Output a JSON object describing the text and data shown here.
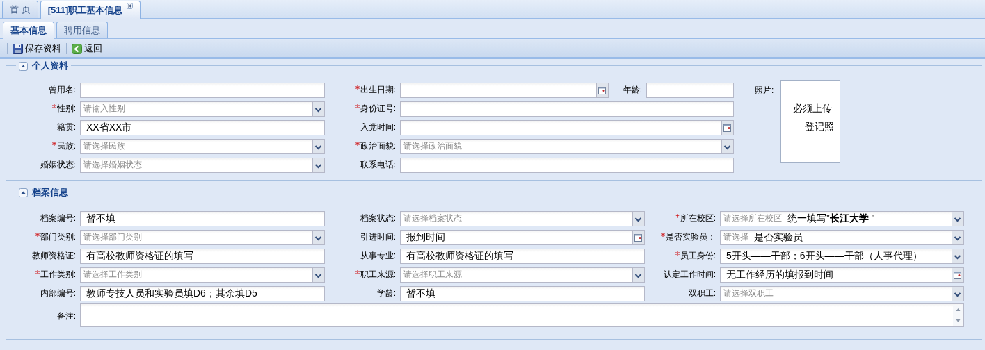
{
  "top_tabs": [
    {
      "label": "首 页",
      "selected": false,
      "closable": false
    },
    {
      "label": "[511]职工基本信息",
      "selected": true,
      "closable": true
    }
  ],
  "sub_tabs": [
    {
      "label": "基本信息",
      "selected": true
    },
    {
      "label": "聘用信息",
      "selected": false
    }
  ],
  "toolbar": [
    {
      "label": "保存资料",
      "kind": "save"
    },
    {
      "label": "返回",
      "kind": "back"
    }
  ],
  "sections": [
    {
      "title": "个人资料",
      "expanded": true,
      "kind": "personal",
      "rows": [
        {
          "fields": [
            {
              "label": "曾用名:",
              "required": false,
              "kind": "text"
            },
            {
              "label": "出生日期:",
              "required": true,
              "kind": "date"
            },
            {
              "label": "年龄:",
              "required": false,
              "kind": "text"
            }
          ]
        },
        {
          "fields": [
            {
              "label": "性别:",
              "required": true,
              "kind": "combo",
              "placeholder": "请输入性别"
            },
            {
              "label": "身份证号:",
              "required": true,
              "kind": "text"
            }
          ]
        },
        {
          "fields": [
            {
              "label": "籍贯:",
              "required": false,
              "kind": "text",
              "value": "XX省XX市"
            },
            {
              "label": "入党时间:",
              "required": false,
              "kind": "date"
            }
          ]
        },
        {
          "fields": [
            {
              "label": "民族:",
              "required": true,
              "kind": "combo",
              "placeholder": "请选择民族"
            },
            {
              "label": "政治面貌:",
              "required": true,
              "kind": "combo",
              "placeholder": "请选择政治面貌"
            }
          ]
        },
        {
          "fields": [
            {
              "label": "婚姻状态:",
              "required": false,
              "kind": "combo",
              "placeholder": "请选择婚姻状态"
            },
            {
              "label": "联系电话:",
              "required": false,
              "kind": "text"
            }
          ]
        }
      ],
      "photo": {
        "label": "照片:",
        "notes": [
          "必须上传",
          "登记照"
        ]
      }
    },
    {
      "title": "档案信息",
      "expanded": true,
      "kind": "archive",
      "rows": [
        {
          "fields": [
            {
              "label": "档案编号:",
              "required": false,
              "kind": "text",
              "value": "暂不填"
            },
            {
              "label": "档案状态:",
              "required": false,
              "kind": "combo",
              "placeholder": "请选择档案状态"
            },
            {
              "label": "所在校区:",
              "required": true,
              "kind": "combo",
              "placeholder": "请选择所在校区",
              "value": "统一填写”**长江大学** ”"
            }
          ]
        },
        {
          "fields": [
            {
              "label": "部门类别:",
              "required": true,
              "kind": "combo",
              "placeholder": "请选择部门类别"
            },
            {
              "label": "引进时间:",
              "required": false,
              "kind": "date",
              "value": "报到时间"
            },
            {
              "label": "是否实验员：",
              "required": true,
              "kind": "combo",
              "placeholder": "请选择",
              "value": "是否实验员"
            }
          ]
        },
        {
          "fields": [
            {
              "label": "教师资格证:",
              "required": false,
              "kind": "text",
              "value": "有高校教师资格证的填写"
            },
            {
              "label": "从事专业:",
              "required": false,
              "kind": "text",
              "value": "有高校教师资格证的填写"
            },
            {
              "label": "员工身份:",
              "required": true,
              "kind": "combo",
              "value": "5开头——干部；6开头——干部（人事代理）"
            }
          ]
        },
        {
          "fields": [
            {
              "label": "工作类别:",
              "required": true,
              "kind": "combo",
              "placeholder": "请选择工作类别"
            },
            {
              "label": "职工来源:",
              "required": true,
              "kind": "combo",
              "placeholder": "请选择职工来源"
            },
            {
              "label": "认定工作时间:",
              "required": false,
              "kind": "date",
              "value": "无工作经历的填报到时间"
            }
          ]
        },
        {
          "fields": [
            {
              "label": "内部编号:",
              "required": false,
              "kind": "text",
              "value": "教师专技人员和实验员填D6；其余填D5"
            },
            {
              "label": "学龄:",
              "required": false,
              "kind": "text",
              "value": "暂不填"
            },
            {
              "label": "双职工:",
              "required": false,
              "kind": "combo",
              "placeholder": "请选择双职工"
            }
          ]
        },
        {
          "fields": [
            {
              "label": "备注:",
              "required": false,
              "kind": "textarea"
            }
          ]
        }
      ]
    }
  ]
}
